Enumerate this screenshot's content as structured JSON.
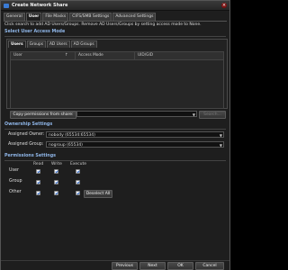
{
  "window": {
    "title": "Create Network Share"
  },
  "tabs": [
    "General",
    "User",
    "File Masks",
    "CIFS/SMB Settings",
    "Advanced Settings"
  ],
  "description": "Click search to add AD Users/Groups. Remove AD Users/Groups by setting access mode to None.",
  "user_access": {
    "section_title": "Select User Access Mode",
    "subtabs": [
      "Users",
      "Groups",
      "AD Users",
      "AD Groups"
    ],
    "columns": [
      "User",
      "Access Mode",
      "UID/GID"
    ],
    "copy_button": "Copy permissions from share:",
    "copy_value": "",
    "search_button": "Search..."
  },
  "ownership": {
    "section_title": "Ownership Settings",
    "owner_label": "Assigned Owner:",
    "owner_value": "nobody (65534:65534)",
    "group_label": "Assigned Group:",
    "group_value": "nogroup (65534)"
  },
  "permissions": {
    "section_title": "Permissions Settings",
    "headers": [
      "Read",
      "Write",
      "Execute"
    ],
    "rows": [
      {
        "label": "User",
        "read": true,
        "write": true,
        "execute": true
      },
      {
        "label": "Group",
        "read": true,
        "write": true,
        "execute": true
      },
      {
        "label": "Other",
        "read": true,
        "write": true,
        "execute": true
      }
    ],
    "deselect_button": "Deselect All"
  },
  "footer": {
    "previous": "Previous",
    "next": "Next",
    "ok": "OK",
    "cancel": "Cancel"
  }
}
